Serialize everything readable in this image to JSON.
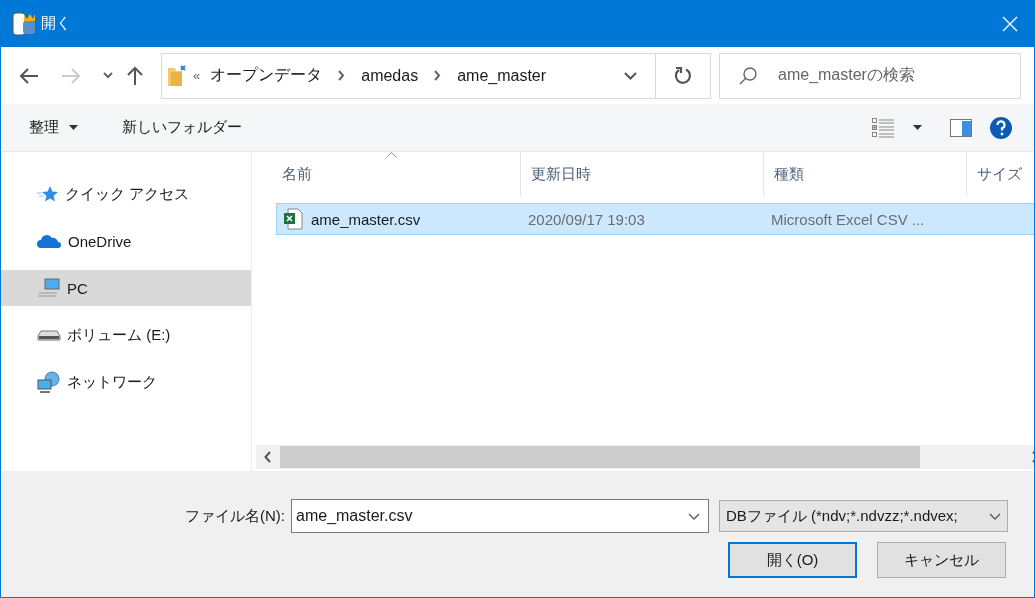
{
  "window": {
    "title": "開く"
  },
  "address": {
    "overflow": "«",
    "path": [
      "オープンデータ",
      "amedas",
      "ame_master"
    ]
  },
  "search": {
    "placeholder": "ame_masterの検索"
  },
  "toolbar": [
    {
      "label": "整理",
      "dropdown": true
    },
    {
      "label": "新しいフォルダー",
      "dropdown": false
    }
  ],
  "sidebar": {
    "items": [
      {
        "label": "クイック アクセス",
        "kind": "star",
        "selected": false
      },
      {
        "label": "OneDrive",
        "kind": "cloud",
        "selected": false
      },
      {
        "label": "PC",
        "kind": "pc",
        "selected": true
      },
      {
        "label": "ボリューム (E:)",
        "kind": "drive",
        "selected": false
      },
      {
        "label": "ネットワーク",
        "kind": "network",
        "selected": false
      }
    ]
  },
  "table": {
    "columns": [
      {
        "label": "名前",
        "sorted": true
      },
      {
        "label": "更新日時",
        "sorted": false
      },
      {
        "label": "種類",
        "sorted": false
      },
      {
        "label": "サイズ",
        "sorted": false
      }
    ],
    "rows": [
      {
        "name": "ame_master.csv",
        "modified": "2020/09/17 19:03",
        "type": "Microsoft Excel CSV ...",
        "selected": true
      }
    ]
  },
  "file_name": {
    "label": "ファイル名(N):",
    "value": "ame_master.csv"
  },
  "file_type": {
    "value": "DBファイル (*ndv;*.ndvzz;*.ndvex;"
  },
  "buttons": [
    {
      "label": "開く(O)",
      "default": true
    },
    {
      "label": "キャンセル",
      "default": false
    }
  ]
}
